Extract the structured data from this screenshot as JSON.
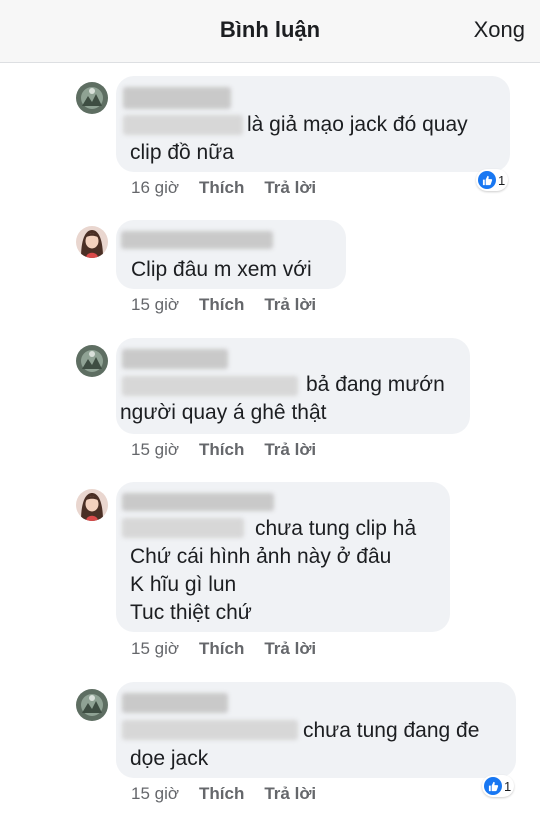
{
  "header": {
    "title": "Bình luận",
    "done_label": "Xong"
  },
  "comments": [
    {
      "avatar": "user-avatar-dark",
      "lines": [
        "là giả mạo jack đó quay",
        "clip đồ nữa"
      ],
      "time": "16 giờ",
      "like_label": "Thích",
      "reply_label": "Trả lời",
      "reaction_icon": "like-icon",
      "reaction_count": "1"
    },
    {
      "avatar": "user-avatar-girl",
      "lines": [
        "Clip đâu m xem với"
      ],
      "time": "15 giờ",
      "like_label": "Thích",
      "reply_label": "Trả lời"
    },
    {
      "avatar": "user-avatar-dark",
      "lines": [
        "bả đang mướn",
        "người quay á ghê thật"
      ],
      "time": "15 giờ",
      "like_label": "Thích",
      "reply_label": "Trả lời"
    },
    {
      "avatar": "user-avatar-girl",
      "lines": [
        "chưa tung clip hả",
        "Chứ cái hình ảnh này ở đâu",
        "K hĩu gì lun",
        "Tuc thiệt chứ"
      ],
      "time": "15 giờ",
      "like_label": "Thích",
      "reply_label": "Trả lời"
    },
    {
      "avatar": "user-avatar-dark",
      "lines": [
        "chưa tung đang đe",
        "dọe jack"
      ],
      "time": "15 giờ",
      "like_label": "Thích",
      "reply_label": "Trả lời",
      "reaction_icon": "like-icon",
      "reaction_count": "1"
    }
  ]
}
